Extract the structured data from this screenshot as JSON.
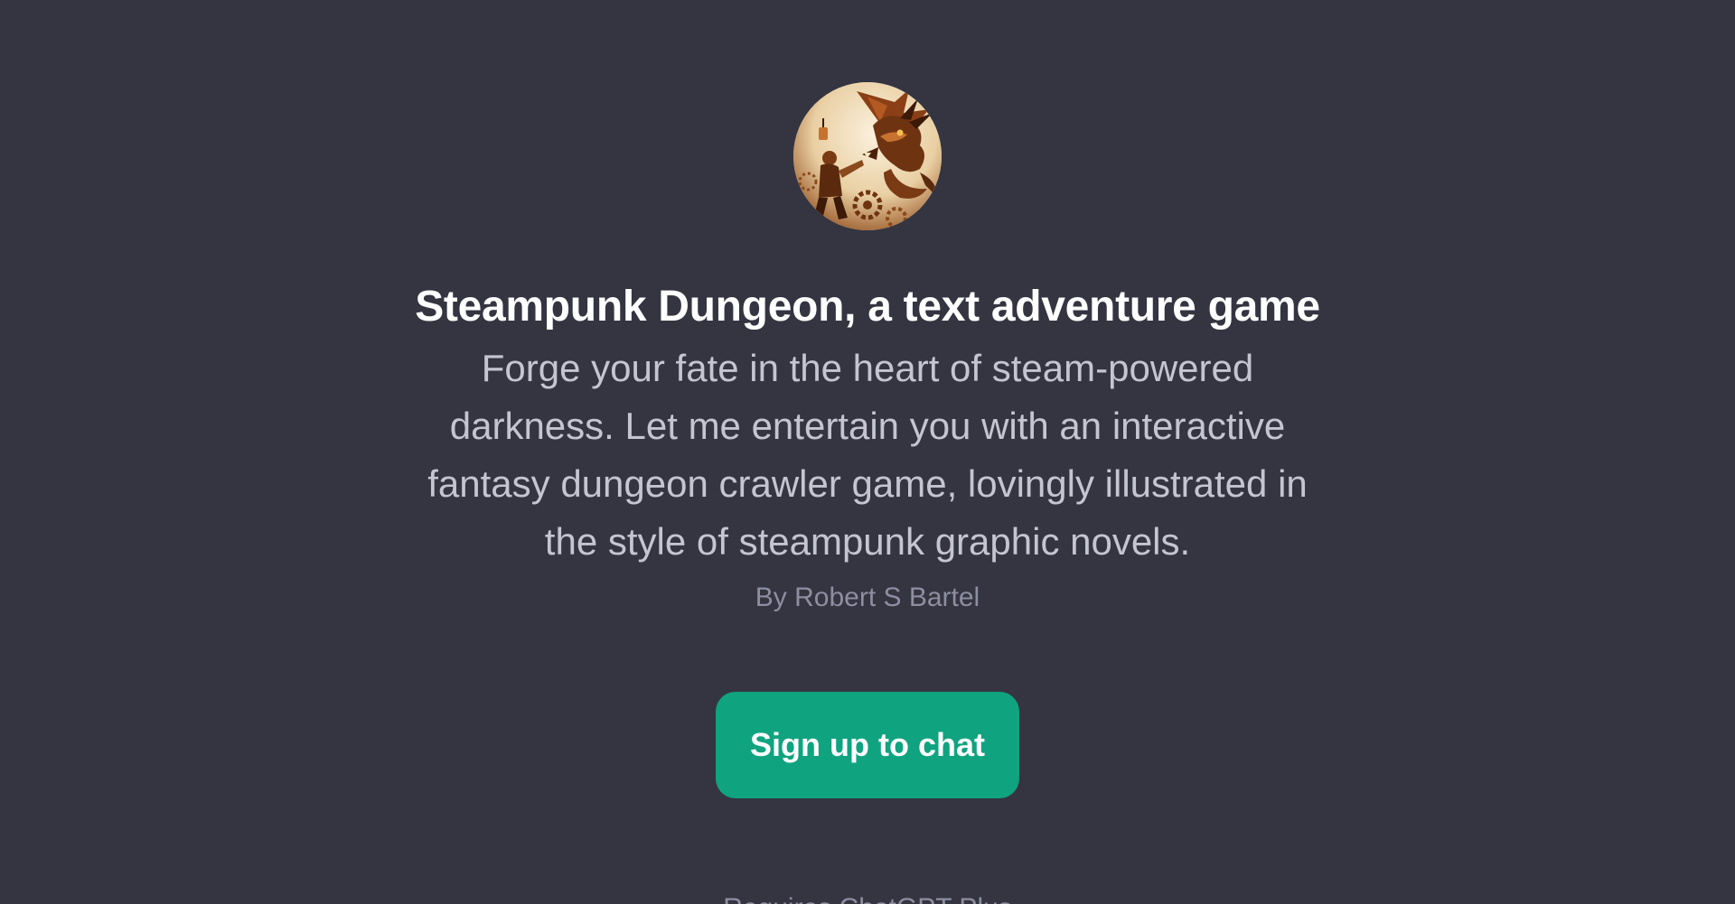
{
  "gpt": {
    "avatar_alt": "Steampunk Dungeon avatar",
    "title": "Steampunk Dungeon, a text adventure game",
    "description": "Forge your fate in the heart of steam-powered darkness. Let me entertain you with an interactive fantasy dungeon crawler game, lovingly illustrated in the style of steampunk graphic novels.",
    "author": "By Robert S Bartel"
  },
  "actions": {
    "signup_label": "Sign up to chat"
  },
  "footer": {
    "text": "Requires ChatGPT Plus"
  },
  "colors": {
    "background": "#343541",
    "accent": "#10a37f",
    "title": "#ffffff",
    "description": "#c5c5d2",
    "muted": "#8e8ea0"
  }
}
